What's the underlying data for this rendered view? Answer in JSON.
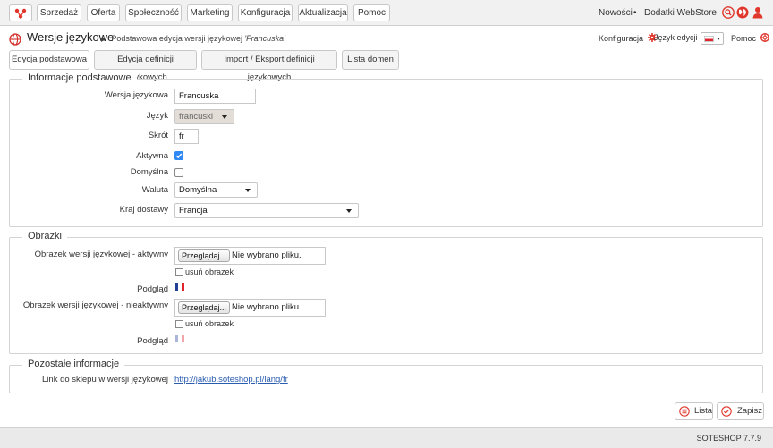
{
  "nav": {
    "items": [
      "Sprzedaż",
      "Oferta",
      "Społeczność",
      "Marketing",
      "Konfiguracja",
      "Aktualizacja",
      "Pomoc"
    ],
    "news": "Nowości",
    "separator": "•",
    "addons": "Dodatki WebStore"
  },
  "header": {
    "title": "Wersje językowe",
    "breadcrumb_prefix": "Podstawowa edycja wersji językowej ",
    "breadcrumb_name": "'Francuska'",
    "config": "Konfiguracja",
    "edit_language": "Język edycji",
    "help": "Pomoc"
  },
  "tabs": [
    "Edycja podstawowa",
    "Edycja definicji językowych",
    "Import / Eksport definicji językowych",
    "Lista domen"
  ],
  "basic": {
    "legend": "Informacje podstawowe",
    "version_label": "Wersja językowa",
    "version_value": "Francuska",
    "language_label": "Język",
    "language_value": "francuski",
    "short_label": "Skrót",
    "short_value": "fr",
    "active_label": "Aktywna",
    "active_checked": true,
    "default_label": "Domyślna",
    "default_checked": false,
    "currency_label": "Waluta",
    "currency_value": "Domyślna",
    "country_label": "Kraj dostawy",
    "country_value": "Francja"
  },
  "images": {
    "legend": "Obrazki",
    "active_label": "Obrazek wersji językowej - aktywny",
    "inactive_label": "Obrazek wersji językowej - nieaktywny",
    "browse": "Przeglądaj...",
    "no_file": "Nie wybrano pliku.",
    "remove": "usuń obrazek",
    "preview": "Podgląd"
  },
  "other": {
    "legend": "Pozostałe informacje",
    "link_label": "Link do sklepu w wersji językowej",
    "link_value": "http://jakub.soteshop.pl/lang/fr"
  },
  "actions": {
    "list": "Lista",
    "save": "Zapisz"
  },
  "footer": {
    "version": "SOTESHOP 7.7.9"
  },
  "colors": {
    "accent_red": "#e0362c",
    "link_blue": "#2a5db0",
    "checkbox_blue": "#2f8af5"
  }
}
